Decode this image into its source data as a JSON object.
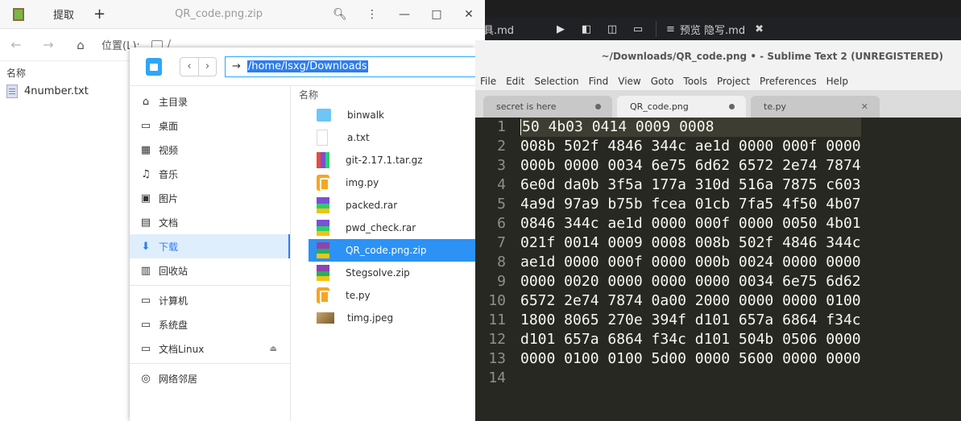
{
  "bg_window": {
    "tab_fragment": "具.md",
    "tab2_label": "预览 隐写.md",
    "tab2_close": "✖"
  },
  "archive": {
    "toolbar": {
      "extract_label": "提取",
      "add_label": "+"
    },
    "title": "QR_code.png.zip",
    "location_label": "位置(L):",
    "location_path": "/",
    "column_name": "名称",
    "files": [
      {
        "name": "4number.txt",
        "icon": "text-file-icon"
      }
    ]
  },
  "file_manager": {
    "path": "/home/lsxg/Downloads",
    "column_name": "名称",
    "sidebar": [
      {
        "label": "主目录",
        "icon": "home-icon"
      },
      {
        "label": "桌面",
        "icon": "desktop-icon"
      },
      {
        "label": "视频",
        "icon": "video-icon"
      },
      {
        "label": "音乐",
        "icon": "music-icon"
      },
      {
        "label": "图片",
        "icon": "picture-icon"
      },
      {
        "label": "文档",
        "icon": "document-icon"
      },
      {
        "label": "下载",
        "icon": "download-icon",
        "active": true
      },
      {
        "label": "回收站",
        "icon": "trash-icon"
      },
      {
        "label": "计算机",
        "icon": "computer-icon"
      },
      {
        "label": "系统盘",
        "icon": "disk-icon"
      },
      {
        "label": "文档Linux",
        "icon": "disk-icon"
      },
      {
        "label": "网络邻居",
        "icon": "network-icon"
      }
    ],
    "files": [
      {
        "name": "binwalk",
        "icon": "folder-icon"
      },
      {
        "name": "a.txt",
        "icon": "blank-file-icon"
      },
      {
        "name": "git-2.17.1.tar.gz",
        "icon": "archive-icon"
      },
      {
        "name": "img.py",
        "icon": "python-icon"
      },
      {
        "name": "packed.rar",
        "icon": "rar-icon"
      },
      {
        "name": "pwd_check.rar",
        "icon": "rar-icon"
      },
      {
        "name": "QR_code.png.zip",
        "icon": "zip-icon",
        "selected": true
      },
      {
        "name": "Stegsolve.zip",
        "icon": "zip-icon"
      },
      {
        "name": "te.py",
        "icon": "python-icon"
      },
      {
        "name": "timg.jpeg",
        "icon": "image-icon"
      }
    ]
  },
  "sublime": {
    "title": "~/Downloads/QR_code.png  •  - Sublime Text 2 (UNREGISTERED)",
    "menu": [
      "File",
      "Edit",
      "Selection",
      "Find",
      "View",
      "Goto",
      "Tools",
      "Project",
      "Preferences",
      "Help"
    ],
    "tabs": [
      {
        "label": "secret is here",
        "state": "modified"
      },
      {
        "label": "QR_code.png",
        "state": "modified",
        "active": true
      },
      {
        "label": "te.py",
        "state": "close"
      }
    ],
    "lines": [
      "50 4b03 0414 0009 0008",
      "008b 502f 4846 344c ae1d 0000 000f 0000",
      "000b 0000 0034 6e75 6d62 6572 2e74 7874",
      "6e0d da0b 3f5a 177a 310d 516a 7875 c603",
      "4a9d 97a9 b75b fcea 01cb 7fa5 4f50 4b07",
      "0846 344c ae1d 0000 000f 0000 0050 4b01",
      "021f 0014 0009 0008 008b 502f 4846 344c",
      "ae1d 0000 000f 0000 000b 0024 0000 0000",
      "0000 0020 0000 0000 0000 0034 6e75 6d62",
      "6572 2e74 7874 0a00 2000 0000 0000 0100",
      "1800 8065 270e 394f d101 657a 6864 f34c",
      "d101 657a 6864 f34c d101 504b 0506 0000",
      "0000 0100 0100 5d00 0000 5600 0000 0000",
      ""
    ],
    "line_numbers": [
      "1",
      "2",
      "3",
      "4",
      "5",
      "6",
      "7",
      "8",
      "9",
      "10",
      "11",
      "12",
      "13",
      "14"
    ]
  }
}
